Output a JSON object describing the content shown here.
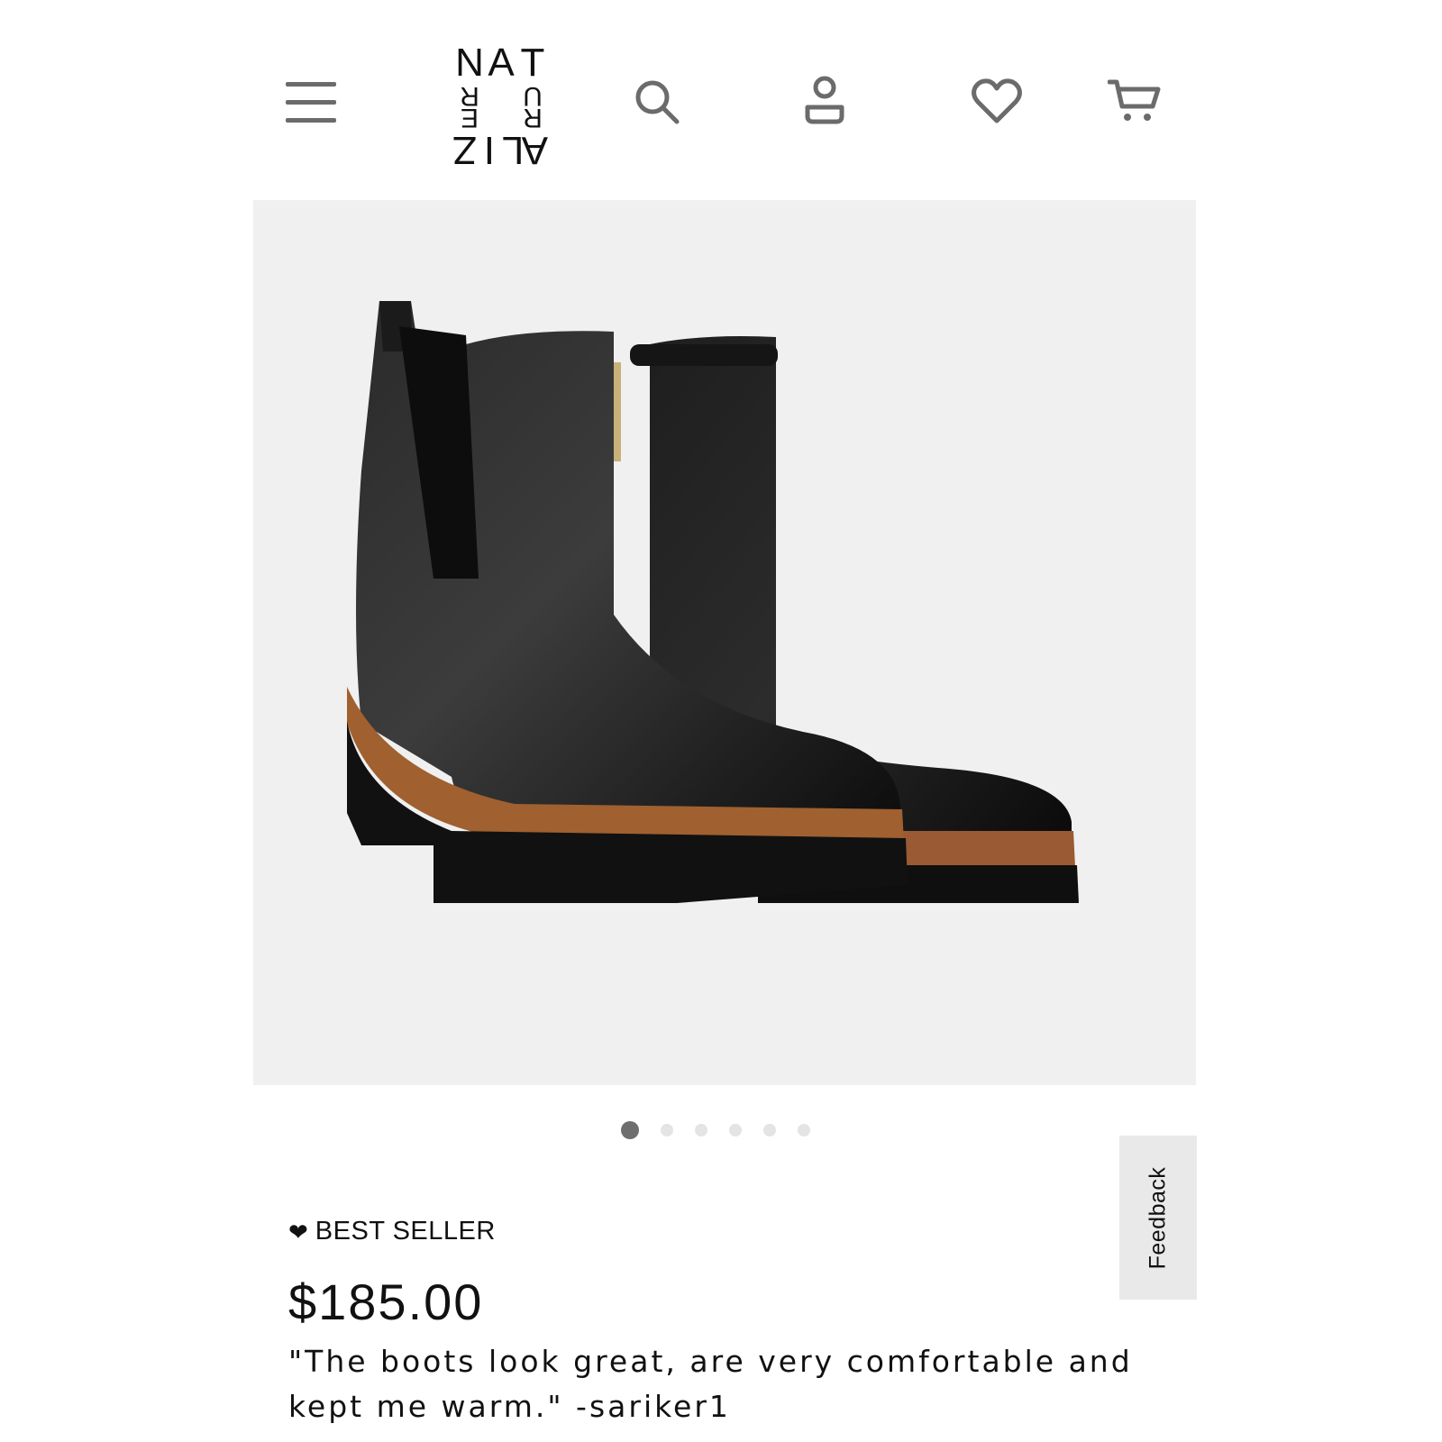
{
  "header": {
    "logo": {
      "brand_name": "NATURALIZER",
      "row1": [
        "N",
        "A",
        "T"
      ],
      "row2": [
        "R",
        "",
        "U"
      ],
      "row2b": [
        "E",
        "",
        "R"
      ],
      "row3": [
        "Z",
        "I",
        "L",
        "A"
      ]
    },
    "icons": {
      "menu": "hamburger-menu-icon",
      "search": "search-icon",
      "account": "user-account-icon",
      "wishlist": "heart-icon",
      "cart": "shopping-cart-icon"
    }
  },
  "product": {
    "image_alt": "Black leather ankle boots with lug sole",
    "carousel": {
      "total": 6,
      "active": 1
    },
    "badge": {
      "icon": "heart-icon",
      "label": "BEST SELLER"
    },
    "price": "$185.00",
    "quote": "\"The boots look great, are very comfortable and kept me warm.\" -sariker1"
  },
  "feedback_tab": {
    "label": "Feedback"
  },
  "colors": {
    "accent": "#111111",
    "image_bg": "#f0f0f0",
    "icon_gray": "#6b6b6b",
    "dot_active": "#6e6e6e",
    "dot_inactive": "#e4e4e4",
    "feedback_bg": "#e9e9e9"
  }
}
